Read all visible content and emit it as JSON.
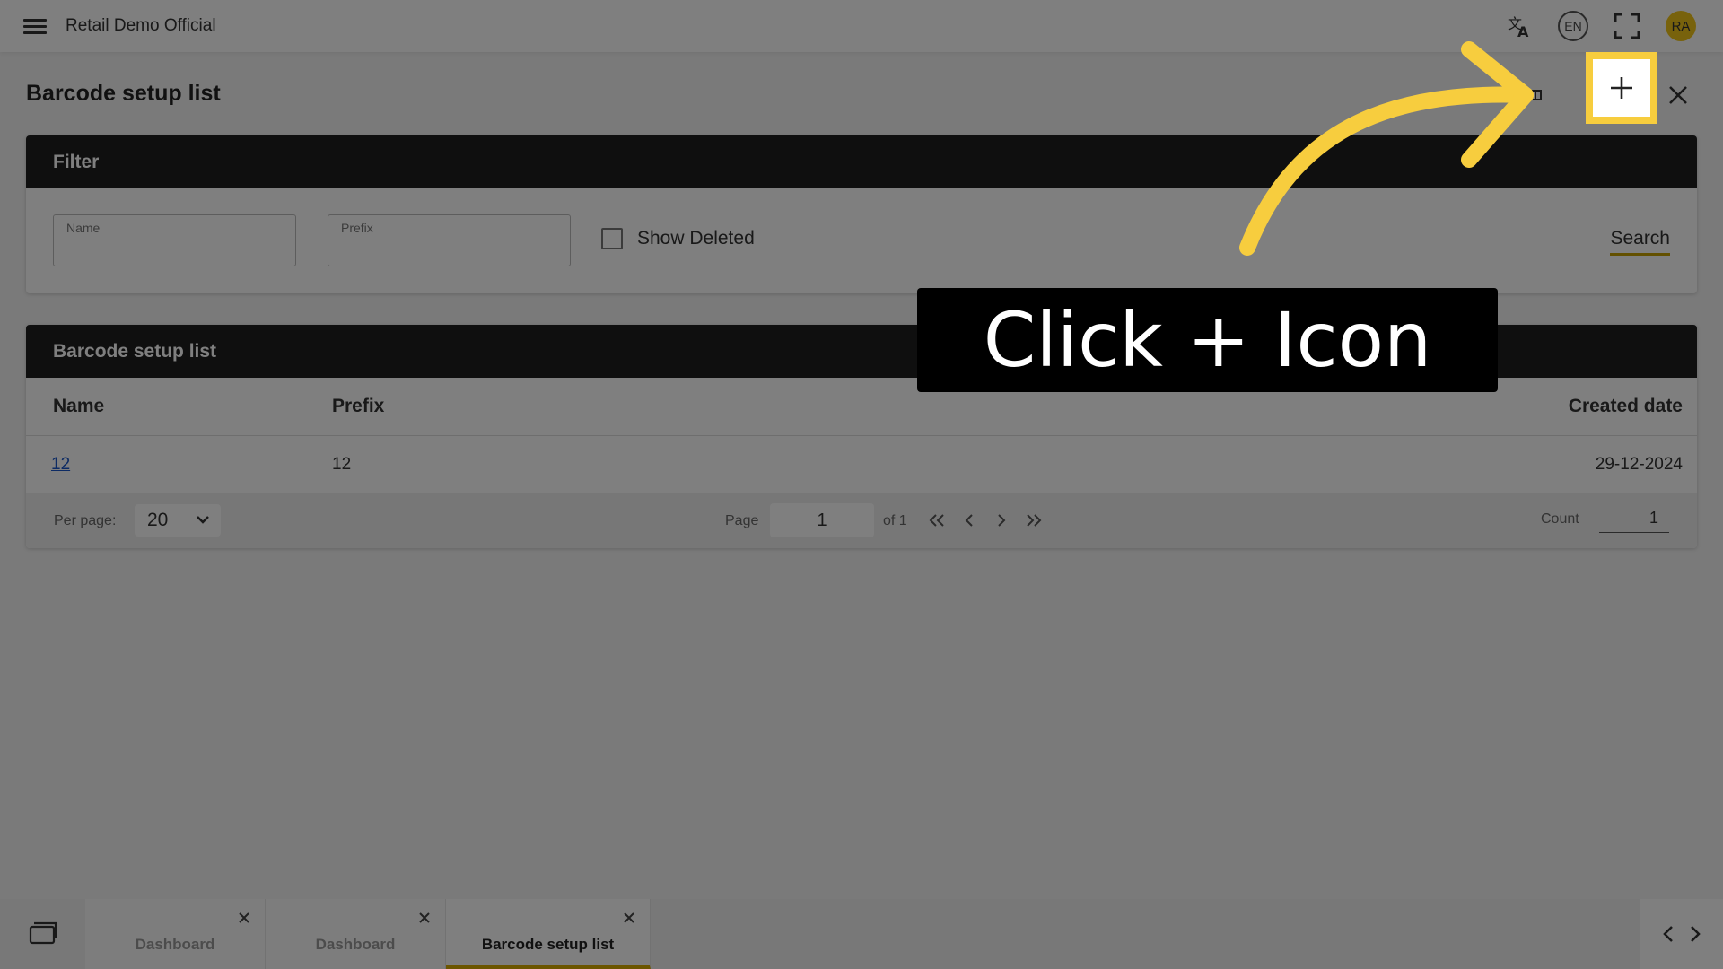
{
  "topbar": {
    "app_title": "Retail Demo Official",
    "lang_code": "EN",
    "avatar_initials": "RA",
    "icons": [
      "menu-icon",
      "translate-icon",
      "fullscreen-icon"
    ]
  },
  "page": {
    "title": "Barcode setup list"
  },
  "filter": {
    "heading": "Filter",
    "name_label": "Name",
    "name_value": "",
    "prefix_label": "Prefix",
    "prefix_value": "",
    "show_deleted_label": "Show Deleted",
    "show_deleted_checked": false,
    "search_label": "Search"
  },
  "list": {
    "heading": "Barcode setup list",
    "columns": [
      "Name",
      "Prefix",
      "Created date"
    ],
    "rows": [
      {
        "name": "12",
        "prefix": "12",
        "created": "29-12-2024"
      }
    ]
  },
  "pager": {
    "per_page_label": "Per page:",
    "per_page_value": "20",
    "page_label": "Page",
    "page_value": "1",
    "of_label": "of 1",
    "count_label": "Count",
    "count_value": "1"
  },
  "tabs": [
    {
      "label": "Dashboard",
      "active": false
    },
    {
      "label": "Dashboard",
      "active": false
    },
    {
      "label": "Barcode setup list",
      "active": true
    }
  ],
  "overlay": {
    "callout_text": "Click + Icon",
    "accent_color": "#f7cd3e",
    "dim_color": "#000000"
  }
}
